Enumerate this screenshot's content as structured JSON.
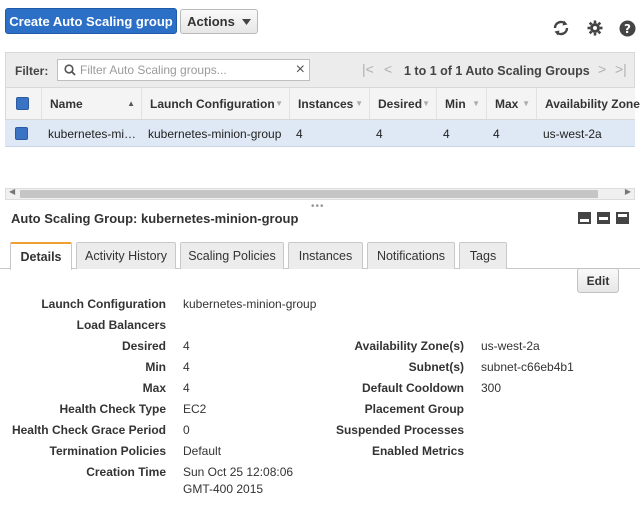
{
  "toolbar": {
    "create_label": "Create Auto Scaling group",
    "actions_label": "Actions",
    "icons": [
      "refresh-icon",
      "gear-icon",
      "help-icon"
    ]
  },
  "filter": {
    "label": "Filter:",
    "placeholder": "Filter Auto Scaling groups...",
    "value": "",
    "pager_text": "1 to 1 of 1 Auto Scaling Groups"
  },
  "grid": {
    "columns": [
      "Name",
      "Launch Configuration",
      "Instances",
      "Desired",
      "Min",
      "Max",
      "Availability Zones"
    ],
    "rows": [
      {
        "name": "kubernetes-mi…",
        "launch_configuration": "kubernetes-minion-group",
        "instances": "4",
        "desired": "4",
        "min": "4",
        "max": "4",
        "availability_zones": "us-west-2a"
      }
    ]
  },
  "detail": {
    "title": "Auto Scaling Group: kubernetes-minion-group",
    "tabs": [
      "Details",
      "Activity History",
      "Scaling Policies",
      "Instances",
      "Notifications",
      "Tags"
    ],
    "active_tab": "Details",
    "edit_label": "Edit",
    "left": [
      {
        "label": "Launch Configuration",
        "value": "kubernetes-minion-group"
      },
      {
        "label": "Load Balancers",
        "value": ""
      },
      {
        "label": "Desired",
        "value": "4"
      },
      {
        "label": "Min",
        "value": "4"
      },
      {
        "label": "Max",
        "value": "4"
      },
      {
        "label": "Health Check Type",
        "value": "EC2"
      },
      {
        "label": "Health Check Grace Period",
        "value": "0"
      },
      {
        "label": "Termination Policies",
        "value": "Default"
      },
      {
        "label": "Creation Time",
        "value": "Sun Oct 25 12:08:06",
        "value2": "GMT-400 2015"
      }
    ],
    "right": [
      {
        "label": "Availability Zone(s)",
        "value": "us-west-2a"
      },
      {
        "label": "Subnet(s)",
        "value": "subnet-c66eb4b1"
      },
      {
        "label": "Default Cooldown",
        "value": "300"
      },
      {
        "label": "Placement Group",
        "value": ""
      },
      {
        "label": "Suspended Processes",
        "value": ""
      },
      {
        "label": "Enabled Metrics",
        "value": ""
      }
    ]
  },
  "colors": {
    "primary": "#2c6fc7",
    "selected_row": "#dfe9f5",
    "active_tab_accent": "#f0a030"
  }
}
